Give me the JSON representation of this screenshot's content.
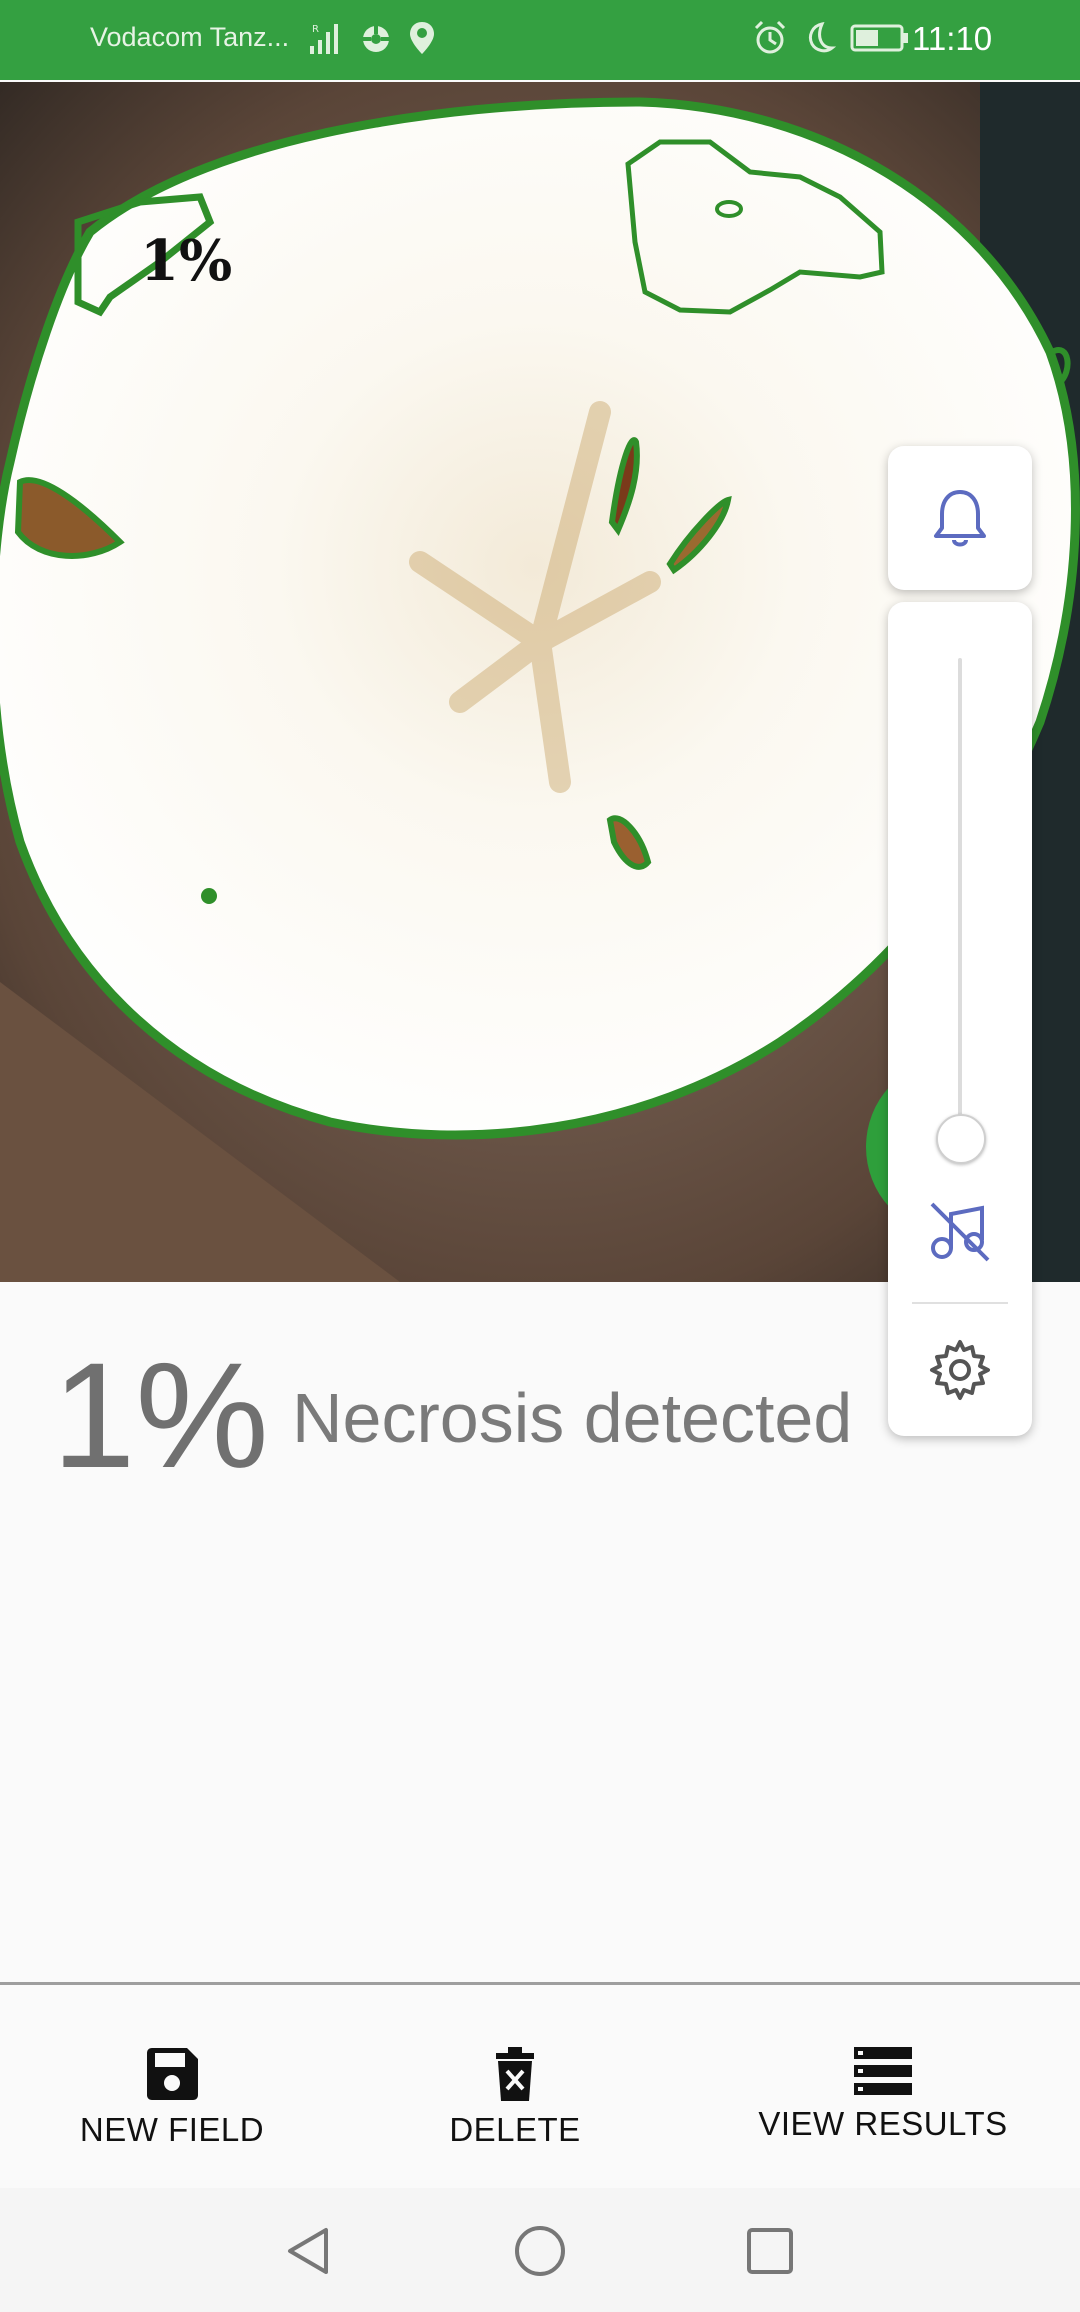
{
  "status_bar": {
    "carrier": "Vodacom Tanz...",
    "time": "11:10",
    "icons": [
      "signal-icon",
      "data-saver-icon",
      "location-icon",
      "alarm-icon",
      "moon-icon",
      "battery-icon"
    ]
  },
  "photo": {
    "overlay_percentage": "1%",
    "outline_color": "#2f8f2a"
  },
  "volume_panel": {
    "icons": [
      "bell-icon",
      "music-off-icon",
      "gear-icon"
    ],
    "accent_color": "#5c6bc0",
    "volume_level": 0.05
  },
  "result": {
    "percentage": "1%",
    "label": "Necrosis detected"
  },
  "bottom_actions": [
    {
      "label": "NEW FIELD",
      "icon": "save-icon"
    },
    {
      "label": "DELETE",
      "icon": "delete-icon"
    },
    {
      "label": "VIEW RESULTS",
      "icon": "list-icon"
    }
  ],
  "nav_bar": {
    "icons": [
      "back-icon",
      "home-icon",
      "recents-icon"
    ]
  },
  "colors": {
    "status_bar": "#34a041",
    "fab": "#2e9f3b"
  }
}
